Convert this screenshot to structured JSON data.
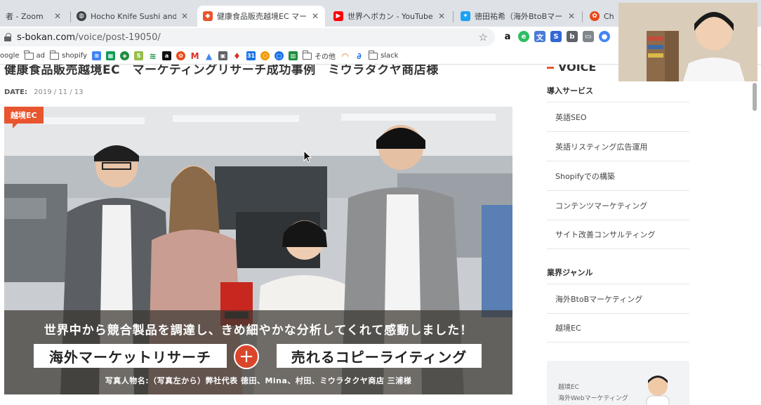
{
  "tabs": [
    {
      "label": "者 - Zoom",
      "active": false
    },
    {
      "label": "Hocho Knife Sushi and Sash",
      "active": false
    },
    {
      "label": "健康食品販売越境EC マーケテ",
      "active": true
    },
    {
      "label": "世界へボカン - YouTube",
      "active": false
    },
    {
      "label": "徳田祐希（海外BtoBマーケテ",
      "active": false
    },
    {
      "label": "Chatw",
      "active": false
    }
  ],
  "address": {
    "host": "s-bokan.com",
    "path": "/voice/post-19050/"
  },
  "bookmarks": [
    "oogle",
    "ad",
    "shopify",
    "その他",
    "slack"
  ],
  "page": {
    "title": "健康食品販売越境EC　マーケティングリサーチ成功事例　ミウラタクヤ商店様",
    "date_label": "DATE:",
    "date_value": "2019 / 11 / 13",
    "category_badge": "越境EC",
    "overlay": {
      "headline": "世界中から競合製品を調達し、きめ細やかな分析してくれて感動しました！",
      "service_left": "海外マーケットリサーチ",
      "plus": "+",
      "service_right": "売れるコピーライティング",
      "caption": "写真人物名:（写真左から）弊社代表 徳田、Mina、村田、ミウラタクヤ商店 三浦様"
    }
  },
  "sidebar": {
    "voice_heading": "VOICE",
    "services_heading": "導入サービス",
    "services": [
      "英語SEO",
      "英語リスティング広告運用",
      "Shopifyでの構築",
      "コンテンツマーケティング",
      "サイト改善コンサルティング"
    ],
    "genre_heading": "業界ジャンル",
    "genres": [
      "海外BtoBマーケティング",
      "越境EC"
    ],
    "card_line1": "越境EC",
    "card_line2": "海外Webマーケティング"
  },
  "colors": {
    "accent": "#e8552e",
    "tabbar": "#dee1e6",
    "omnibox": "#f1f3f4"
  }
}
